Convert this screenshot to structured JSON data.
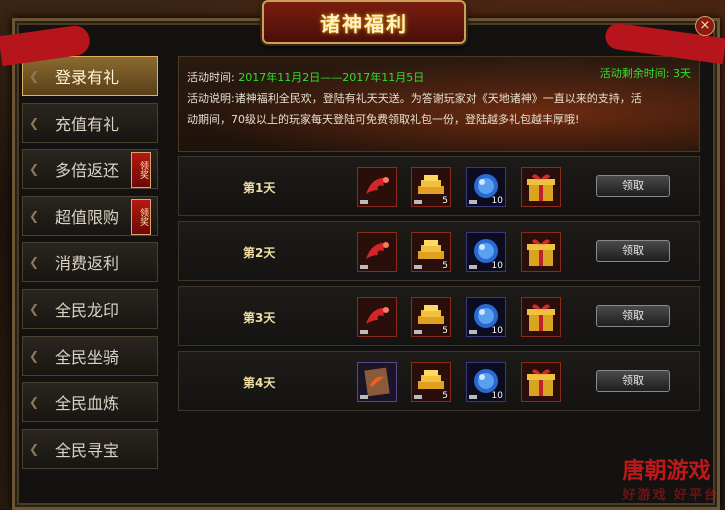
{
  "window": {
    "title": "诸神福利",
    "close_label": "×"
  },
  "sidebar": {
    "items": [
      {
        "label": "登录有礼",
        "active": true,
        "badge": ""
      },
      {
        "label": "充值有礼",
        "active": false,
        "badge": ""
      },
      {
        "label": "多倍返还",
        "active": false,
        "badge": "领奖"
      },
      {
        "label": "超值限购",
        "active": false,
        "badge": "领奖"
      },
      {
        "label": "消费返利",
        "active": false,
        "badge": ""
      },
      {
        "label": "全民龙印",
        "active": false,
        "badge": ""
      },
      {
        "label": "全民坐骑",
        "active": false,
        "badge": ""
      },
      {
        "label": "全民血炼",
        "active": false,
        "badge": ""
      },
      {
        "label": "全民寻宝",
        "active": false,
        "badge": ""
      }
    ]
  },
  "info": {
    "time_label": "活动时间:",
    "time_range": "2017年11月2日——2017年11月5日",
    "remaining": "活动剩余时间: 3天",
    "desc_label": "活动说明:",
    "desc_line1": "诸神福利全民欢，登陆有礼天天送。为答谢玩家对《天地诸神》一直以来的支持，活",
    "desc_line2": "动期间，70级以上的玩家每天登陆可免费领取礼包一份，登陆越多礼包越丰厚哦!"
  },
  "days": [
    {
      "label": "第1天",
      "items": [
        {
          "icon": "red-feather-icon",
          "qty": ""
        },
        {
          "icon": "gold-bars-icon",
          "qty": "5"
        },
        {
          "icon": "blue-orb-icon",
          "qty": "10"
        },
        {
          "icon": "gift-box-icon",
          "qty": ""
        }
      ],
      "button": "领取"
    },
    {
      "label": "第2天",
      "items": [
        {
          "icon": "red-feather-icon",
          "qty": ""
        },
        {
          "icon": "gold-bars-icon",
          "qty": "5"
        },
        {
          "icon": "blue-orb-icon",
          "qty": "10"
        },
        {
          "icon": "gift-box-icon",
          "qty": ""
        }
      ],
      "button": "领取"
    },
    {
      "label": "第3天",
      "items": [
        {
          "icon": "red-feather-icon",
          "qty": ""
        },
        {
          "icon": "gold-bars-icon",
          "qty": "5"
        },
        {
          "icon": "blue-orb-icon",
          "qty": "10"
        },
        {
          "icon": "gift-box-icon",
          "qty": ""
        }
      ],
      "button": "领取"
    },
    {
      "label": "第4天",
      "items": [
        {
          "icon": "scroll-book-icon",
          "qty": ""
        },
        {
          "icon": "gold-bars-icon",
          "qty": "5"
        },
        {
          "icon": "blue-orb-icon",
          "qty": "10"
        },
        {
          "icon": "gift-box-icon",
          "qty": ""
        }
      ],
      "button": "领取"
    }
  ],
  "watermark": {
    "main": "唐朝游戏",
    "sub": "好游戏 好平台"
  },
  "colors": {
    "accent_gold": "#e0b060",
    "highlight_green": "#2fe02f",
    "badge_red": "#b41a12"
  }
}
